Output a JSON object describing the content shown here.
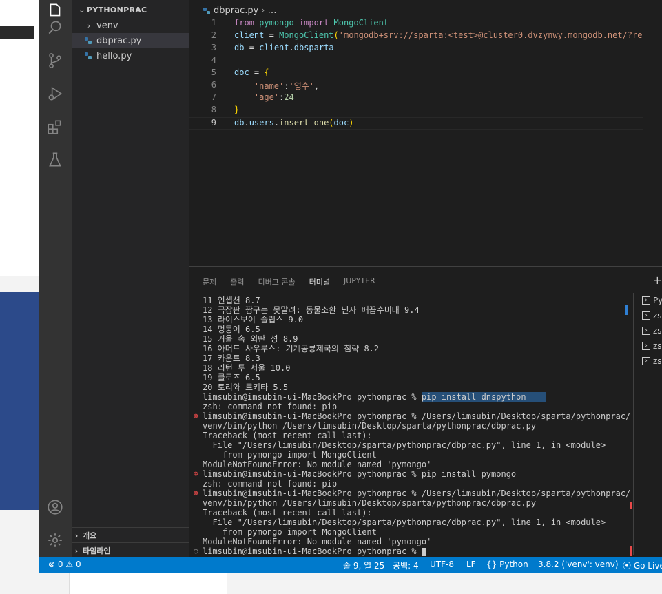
{
  "explorer": {
    "title": "PYTHONPRAC",
    "items": [
      {
        "label": "venv"
      },
      {
        "label": "dbprac.py"
      },
      {
        "label": "hello.py"
      }
    ],
    "outline": "개요",
    "timeline": "타임라인"
  },
  "editor": {
    "breadcrumb_file": "dbprac.py",
    "breadcrumb_more": "…",
    "line_numbers": [
      "1",
      "2",
      "3",
      "4",
      "5",
      "6",
      "7",
      "8",
      "9"
    ]
  },
  "panel": {
    "tabs": [
      "문제",
      "출력",
      "디버그 콘솔",
      "터미널",
      "JUPYTER"
    ],
    "terminal_lines": [
      "11 인셉션 8.7",
      "12 극장판 짱구는 못말려: 동물소환 닌자 배꼽수비대 9.4",
      "13 라이스보이 슬립스 9.0",
      "14 멍뭉이 6.5",
      "15 거울 속 외딴 성 8.9",
      "16 아머드 사우루스: 기계공룡제국의 침략 8.2",
      "17 카운트 8.3",
      "18 리턴 투 서울 10.0",
      "19 클로즈 6.5",
      "20 토리와 로키타 5.5",
      "limsubin@imsubin-ui-MacBookPro pythonprac % ",
      "zsh: command not found: pip",
      "limsubin@imsubin-ui-MacBookPro pythonprac % /Users/limsubin/Desktop/sparta/pythonprac/",
      "venv/bin/python /Users/limsubin/Desktop/sparta/pythonprac/dbprac.py",
      "Traceback (most recent call last):",
      "  File \"/Users/limsubin/Desktop/sparta/pythonprac/dbprac.py\", line 1, in <module>",
      "    from pymongo import MongoClient",
      "ModuleNotFoundError: No module named 'pymongo'",
      "limsubin@imsubin-ui-MacBookPro pythonprac % pip install pymongo",
      "zsh: command not found: pip",
      "limsubin@imsubin-ui-MacBookPro pythonprac % /Users/limsubin/Desktop/sparta/pythonprac/",
      "venv/bin/python /Users/limsubin/Desktop/sparta/pythonprac/dbprac.py",
      "Traceback (most recent call last):",
      "  File \"/Users/limsubin/Desktop/sparta/pythonprac/dbprac.py\", line 1, in <module>",
      "    from pymongo import MongoClient",
      "ModuleNotFoundError: No module named 'pymongo'",
      "limsubin@imsubin-ui-MacBookPro pythonprac % "
    ],
    "highlighted_command": "pip install dnspython",
    "terminal_list": [
      "Py",
      "zs",
      "zs",
      "zs",
      "zs"
    ],
    "plus": "+"
  },
  "status": {
    "errors": "0",
    "warnings": "0",
    "position": "줄 9, 열 25",
    "spaces": "공백: 4",
    "encoding": "UTF-8",
    "eol": "LF",
    "language": "Python",
    "interpreter": "3.8.2 ('venv': venv)",
    "golive": "Go Live"
  },
  "colors": {
    "statusbar": "#007acc",
    "activity": "#333333",
    "sidebar": "#252526",
    "editor": "#1e1e1e"
  }
}
